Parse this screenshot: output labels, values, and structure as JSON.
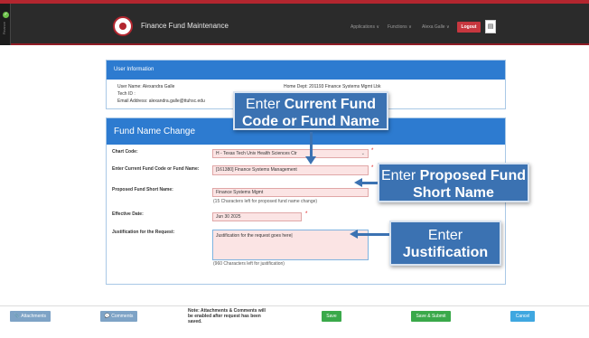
{
  "sidebar": {
    "icon": "check-icon",
    "label": "Finance"
  },
  "header": {
    "title": "Finance Fund Maintenance",
    "menu": [
      "Applications ∨",
      "Functions ∨",
      "Alexa Galle ∨"
    ],
    "logout_label": "Logout",
    "doc_icon": "document-icon"
  },
  "user_info": {
    "title": "User Information",
    "name": "User Name: Alexandra Galle",
    "tech_id": "Tech ID :",
    "email": "Email Address: alexandra.galle@ttuhsc.edu",
    "home_dept": "Home Dept: 201193 Finance Systems Mgmt Lbk"
  },
  "form": {
    "title": "Fund Name Change",
    "chart_code_label": "Chart Code:",
    "chart_code_value": "H - Texas Tech Univ Health Sciences Ctr",
    "current_fund_label": "Enter Current Fund Code or Fund Name:",
    "current_fund_value": "[161380] Finance Systems Management",
    "proposed_label": "Proposed Fund Short Name:",
    "proposed_value": "Finance Systems Mgmt",
    "proposed_hint": "(15 Characters left for proposed fund name change)",
    "effective_label": "Effective Date:",
    "effective_value": "Jun 30 2025",
    "justification_label": "Justification for the Request:",
    "justification_value": "Justification for the request goes here|",
    "justification_hint": "(960 Characters left for justification)",
    "required_mark": "*"
  },
  "callouts": {
    "current_fund": {
      "pre": "Enter ",
      "bold": "Current Fund Code or Fund Name"
    },
    "proposed": {
      "pre": "Enter ",
      "bold": "Proposed Fund Short Name"
    },
    "justification": {
      "pre": "Enter ",
      "bold": "Justification"
    }
  },
  "footer": {
    "attachments_label": "📎 Attachments",
    "comments_label": "💬 Comments",
    "note": "Note: Attachments & Comments will be enabled after request has been saved.",
    "save_label": "Save",
    "save_submit_label": "Save & Submit",
    "cancel_label": "Cancel"
  },
  "colors": {
    "brand": "#b3262f",
    "header_blue": "#2d7bd0",
    "callout_blue": "#3b72b2",
    "button_green": "#3aa94a",
    "button_gray": "#7ea3c6",
    "cancel_blue": "#3fa7e0"
  }
}
